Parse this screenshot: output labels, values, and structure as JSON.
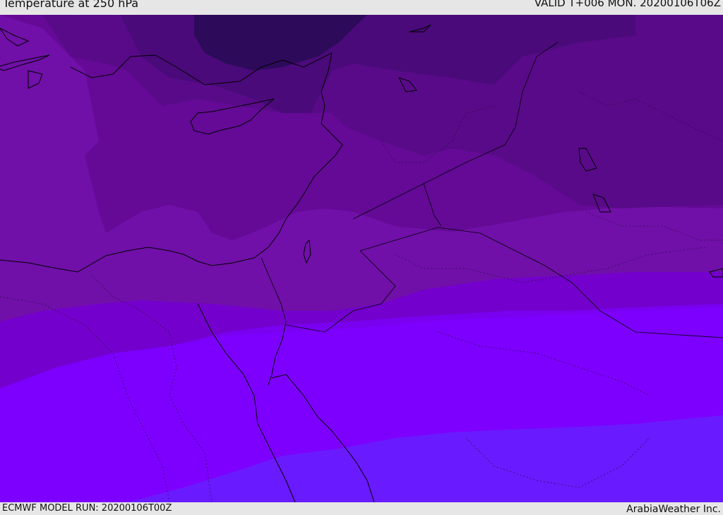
{
  "header": {
    "title": "Temperature at 250 hPa",
    "valid": "VALID T+006 MON. 20200106T06Z"
  },
  "footer": {
    "model_run": "ECMWF MODEL RUN: 20200106T00Z",
    "credit": "ArabiaWeather Inc."
  },
  "map": {
    "region": "Eastern Mediterranean / Middle East",
    "field": "Temperature at 250 hPa",
    "colors": {
      "band_darkest": "#2d0a5a",
      "band_1": "#4a0a7a",
      "band_2": "#580a88",
      "band_3": "#640a96",
      "band_4": "#7010a8",
      "band_5": "#7300cc",
      "band_6": "#7a00f0",
      "band_7": "#7d00ff",
      "band_8": "#6a1aff",
      "coastline": "#000000",
      "border": "#2a0a40"
    }
  }
}
